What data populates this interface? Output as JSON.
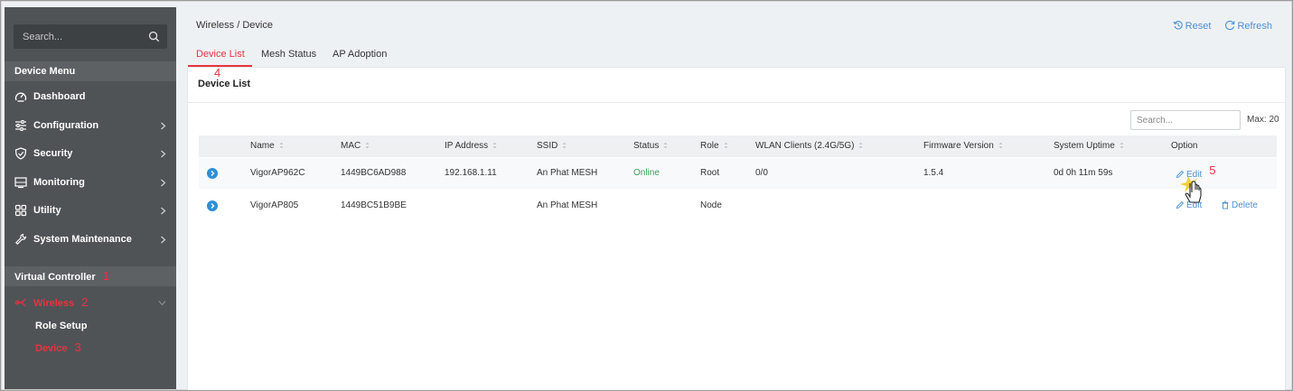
{
  "sidebar": {
    "search_placeholder": "Search...",
    "device_menu_title": "Device Menu",
    "items": [
      {
        "label": "Dashboard",
        "icon": "dashboard-icon"
      },
      {
        "label": "Configuration",
        "icon": "sliders-icon"
      },
      {
        "label": "Security",
        "icon": "shield-icon"
      },
      {
        "label": "Monitoring",
        "icon": "monitor-icon"
      },
      {
        "label": "Utility",
        "icon": "grid-icon"
      },
      {
        "label": "System Maintenance",
        "icon": "wrench-icon"
      }
    ],
    "virtual_controller_title": "Virtual Controller",
    "virtual_controller_step": "1",
    "wireless_label": "Wireless",
    "wireless_step": "2",
    "sub_items": [
      {
        "label": "Role Setup"
      },
      {
        "label": "Device"
      }
    ],
    "device_step": "3"
  },
  "header": {
    "breadcrumb": "Wireless / Device",
    "reset_label": "Reset",
    "refresh_label": "Refresh"
  },
  "tabs": [
    {
      "label": "Device List",
      "active": true
    },
    {
      "label": "Mesh Status"
    },
    {
      "label": "AP Adoption"
    }
  ],
  "tab_step": "4",
  "panel": {
    "title": "Device List",
    "search_placeholder": "Search...",
    "max_label": "Max: 20"
  },
  "table": {
    "columns": [
      "Name",
      "MAC",
      "IP Address",
      "SSID",
      "Status",
      "Role",
      "WLAN Clients (2.4G/5G)",
      "Firmware Version",
      "System Uptime",
      "Option"
    ],
    "rows": [
      {
        "name": "VigorAP962C",
        "mac": "1449BC6AD988",
        "ip": "192.168.1.11",
        "ssid": "An Phat MESH",
        "status": "Online",
        "role": "Root",
        "wlan_clients": "0/0",
        "firmware": "1.5.4",
        "uptime": "0d 0h 11m 59s",
        "edit": "Edit",
        "delete": ""
      },
      {
        "name": "VigorAP805",
        "mac": "1449BC51B9BE",
        "ip": "",
        "ssid": "An Phat MESH",
        "status": "",
        "role": "Node",
        "wlan_clients": "",
        "firmware": "",
        "uptime": "",
        "edit": "Edit",
        "delete": "Delete"
      }
    ],
    "edit_step": "5"
  },
  "colors": {
    "accent_red": "#e8333e",
    "link_blue": "#4b8fd6",
    "online_green": "#3aa35b",
    "sidebar_bg": "#505356"
  }
}
